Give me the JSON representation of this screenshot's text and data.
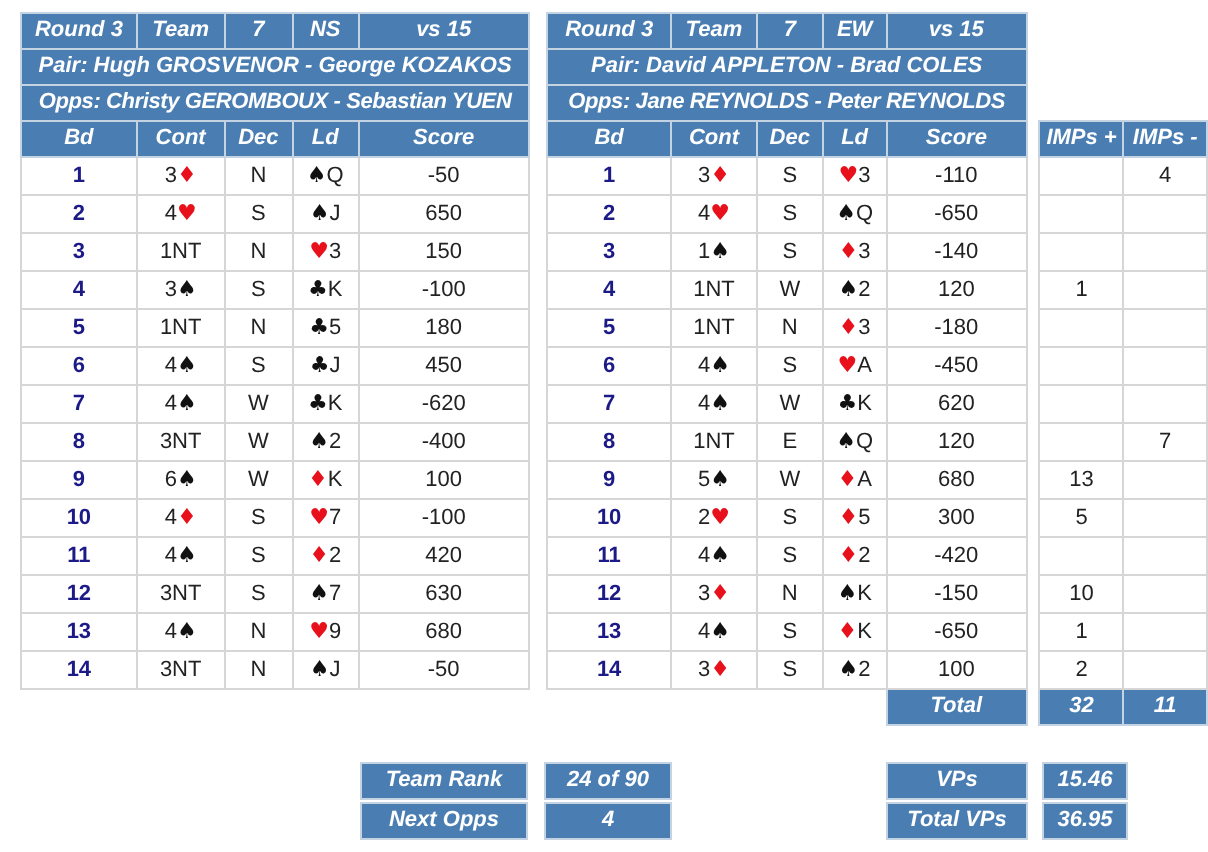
{
  "ns": {
    "header": {
      "round": "Round 3",
      "team_label": "Team",
      "team": "7",
      "direction": "NS",
      "versus": "vs 15"
    },
    "pair": "Pair: Hugh GROSVENOR - George KOZAKOS",
    "opps": "Opps: Christy GEROMBOUX - Sebastian YUEN",
    "columns": [
      "Bd",
      "Cont",
      "Dec",
      "Ld",
      "Score"
    ],
    "rows": [
      {
        "bd": "1",
        "cont": {
          "level": "3",
          "red": true,
          "symbol": "♦"
        },
        "dec": "N",
        "lead": {
          "red": false,
          "symbol": "♠",
          "rank": "Q"
        },
        "score": "-50"
      },
      {
        "bd": "2",
        "cont": {
          "level": "4",
          "red": true,
          "symbol": "♥"
        },
        "dec": "S",
        "lead": {
          "red": false,
          "symbol": "♠",
          "rank": "J"
        },
        "score": "650"
      },
      {
        "bd": "3",
        "cont": {
          "level": "1NT"
        },
        "dec": "N",
        "lead": {
          "red": true,
          "symbol": "♥",
          "rank": "3"
        },
        "score": "150"
      },
      {
        "bd": "4",
        "cont": {
          "level": "3",
          "red": false,
          "symbol": "♠"
        },
        "dec": "S",
        "lead": {
          "red": false,
          "symbol": "♣",
          "rank": "K"
        },
        "score": "-100"
      },
      {
        "bd": "5",
        "cont": {
          "level": "1NT"
        },
        "dec": "N",
        "lead": {
          "red": false,
          "symbol": "♣",
          "rank": "5"
        },
        "score": "180"
      },
      {
        "bd": "6",
        "cont": {
          "level": "4",
          "red": false,
          "symbol": "♠"
        },
        "dec": "S",
        "lead": {
          "red": false,
          "symbol": "♣",
          "rank": "J"
        },
        "score": "450"
      },
      {
        "bd": "7",
        "cont": {
          "level": "4",
          "red": false,
          "symbol": "♠"
        },
        "dec": "W",
        "lead": {
          "red": false,
          "symbol": "♣",
          "rank": "K"
        },
        "score": "-620"
      },
      {
        "bd": "8",
        "cont": {
          "level": "3NT"
        },
        "dec": "W",
        "lead": {
          "red": false,
          "symbol": "♠",
          "rank": "2"
        },
        "score": "-400"
      },
      {
        "bd": "9",
        "cont": {
          "level": "6",
          "red": false,
          "symbol": "♠"
        },
        "dec": "W",
        "lead": {
          "red": true,
          "symbol": "♦",
          "rank": "K"
        },
        "score": "100"
      },
      {
        "bd": "10",
        "cont": {
          "level": "4",
          "red": true,
          "symbol": "♦"
        },
        "dec": "S",
        "lead": {
          "red": true,
          "symbol": "♥",
          "rank": "7"
        },
        "score": "-100"
      },
      {
        "bd": "11",
        "cont": {
          "level": "4",
          "red": false,
          "symbol": "♠"
        },
        "dec": "S",
        "lead": {
          "red": true,
          "symbol": "♦",
          "rank": "2"
        },
        "score": "420"
      },
      {
        "bd": "12",
        "cont": {
          "level": "3NT"
        },
        "dec": "S",
        "lead": {
          "red": false,
          "symbol": "♠",
          "rank": "7"
        },
        "score": "630"
      },
      {
        "bd": "13",
        "cont": {
          "level": "4",
          "red": false,
          "symbol": "♠"
        },
        "dec": "N",
        "lead": {
          "red": true,
          "symbol": "♥",
          "rank": "9"
        },
        "score": "680"
      },
      {
        "bd": "14",
        "cont": {
          "level": "3NT"
        },
        "dec": "N",
        "lead": {
          "red": false,
          "symbol": "♠",
          "rank": "J"
        },
        "score": "-50"
      }
    ]
  },
  "ew": {
    "header": {
      "round": "Round 3",
      "team_label": "Team",
      "team": "7",
      "direction": "EW",
      "versus": "vs 15"
    },
    "pair": "Pair: David APPLETON - Brad COLES",
    "opps": "Opps: Jane REYNOLDS - Peter REYNOLDS",
    "columns": [
      "Bd",
      "Cont",
      "Dec",
      "Ld",
      "Score"
    ],
    "imps_columns": [
      "IMPs +",
      "IMPs -"
    ],
    "rows": [
      {
        "bd": "1",
        "cont": {
          "level": "3",
          "red": true,
          "symbol": "♦"
        },
        "dec": "S",
        "lead": {
          "red": true,
          "symbol": "♥",
          "rank": "3"
        },
        "score": "-110",
        "imps_minus": "4"
      },
      {
        "bd": "2",
        "cont": {
          "level": "4",
          "red": true,
          "symbol": "♥"
        },
        "dec": "S",
        "lead": {
          "red": false,
          "symbol": "♠",
          "rank": "Q"
        },
        "score": "-650"
      },
      {
        "bd": "3",
        "cont": {
          "level": "1",
          "red": false,
          "symbol": "♠"
        },
        "dec": "S",
        "lead": {
          "red": true,
          "symbol": "♦",
          "rank": "3"
        },
        "score": "-140"
      },
      {
        "bd": "4",
        "cont": {
          "level": "1NT"
        },
        "dec": "W",
        "lead": {
          "red": false,
          "symbol": "♠",
          "rank": "2"
        },
        "score": "120",
        "imps_plus": "1"
      },
      {
        "bd": "5",
        "cont": {
          "level": "1NT"
        },
        "dec": "N",
        "lead": {
          "red": true,
          "symbol": "♦",
          "rank": "3"
        },
        "score": "-180"
      },
      {
        "bd": "6",
        "cont": {
          "level": "4",
          "red": false,
          "symbol": "♠"
        },
        "dec": "S",
        "lead": {
          "red": true,
          "symbol": "♥",
          "rank": "A"
        },
        "score": "-450"
      },
      {
        "bd": "7",
        "cont": {
          "level": "4",
          "red": false,
          "symbol": "♠"
        },
        "dec": "W",
        "lead": {
          "red": false,
          "symbol": "♣",
          "rank": "K"
        },
        "score": "620"
      },
      {
        "bd": "8",
        "cont": {
          "level": "1NT"
        },
        "dec": "E",
        "lead": {
          "red": false,
          "symbol": "♠",
          "rank": "Q"
        },
        "score": "120",
        "imps_minus": "7"
      },
      {
        "bd": "9",
        "cont": {
          "level": "5",
          "red": false,
          "symbol": "♠"
        },
        "dec": "W",
        "lead": {
          "red": true,
          "symbol": "♦",
          "rank": "A"
        },
        "score": "680",
        "imps_plus": "13"
      },
      {
        "bd": "10",
        "cont": {
          "level": "2",
          "red": true,
          "symbol": "♥"
        },
        "dec": "S",
        "lead": {
          "red": true,
          "symbol": "♦",
          "rank": "5"
        },
        "score": "300",
        "imps_plus": "5"
      },
      {
        "bd": "11",
        "cont": {
          "level": "4",
          "red": false,
          "symbol": "♠"
        },
        "dec": "S",
        "lead": {
          "red": true,
          "symbol": "♦",
          "rank": "2"
        },
        "score": "-420"
      },
      {
        "bd": "12",
        "cont": {
          "level": "3",
          "red": true,
          "symbol": "♦"
        },
        "dec": "N",
        "lead": {
          "red": false,
          "symbol": "♠",
          "rank": "K"
        },
        "score": "-150",
        "imps_plus": "10"
      },
      {
        "bd": "13",
        "cont": {
          "level": "4",
          "red": false,
          "symbol": "♠"
        },
        "dec": "S",
        "lead": {
          "red": true,
          "symbol": "♦",
          "rank": "K"
        },
        "score": "-650",
        "imps_plus": "1"
      },
      {
        "bd": "14",
        "cont": {
          "level": "3",
          "red": true,
          "symbol": "♦"
        },
        "dec": "S",
        "lead": {
          "red": false,
          "symbol": "♠",
          "rank": "2"
        },
        "score": "100",
        "imps_plus": "2"
      }
    ],
    "total": {
      "label": "Total",
      "imps_plus": "32",
      "imps_minus": "11"
    }
  },
  "team_summary": [
    {
      "label": "Team Rank",
      "value": "24 of 90"
    },
    {
      "label": "Next Opps",
      "value": "4"
    }
  ],
  "vp_summary": [
    {
      "label": "VPs",
      "value": "15.46"
    },
    {
      "label": "Total VPs",
      "value": "36.95"
    }
  ]
}
